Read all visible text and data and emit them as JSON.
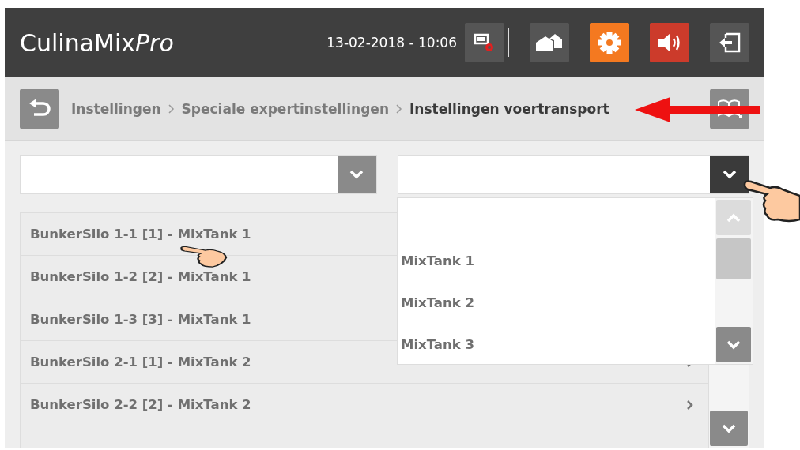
{
  "header": {
    "app_name": "CulinaMix",
    "app_name_suffix": "Pro",
    "datetime": "13-02-2018 - 10:06",
    "buttons": [
      {
        "kind": "screen",
        "color": "#555555"
      },
      {
        "kind": "houses",
        "color": "#555555"
      },
      {
        "kind": "settings",
        "color": "#f47920"
      },
      {
        "kind": "sound",
        "color": "#cc3b2b"
      },
      {
        "kind": "logout",
        "color": "#555555"
      }
    ]
  },
  "breadcrumb": [
    {
      "label": "Instellingen",
      "current": false
    },
    {
      "label": "Speciale expertinstellingen",
      "current": false
    },
    {
      "label": "Instellingen voertransport",
      "current": true
    }
  ],
  "dropdowns": [
    {
      "open": false
    },
    {
      "open": true,
      "options": [
        {
          "kind": "empty"
        },
        {
          "kind": "text",
          "label": "MixTank 1"
        },
        {
          "kind": "text",
          "label": "MixTank 2"
        },
        {
          "kind": "text",
          "label": "MixTank 3"
        }
      ]
    }
  ],
  "rows": [
    {
      "label": "BunkerSilo 1-1 [1] - MixTank 1",
      "chevron": false
    },
    {
      "label": "BunkerSilo 1-2 [2] - MixTank 1",
      "chevron": false
    },
    {
      "label": "BunkerSilo 1-3 [3] - MixTank 1",
      "chevron": false
    },
    {
      "label": "BunkerSilo 2-1 [1] - MixTank 2",
      "chevron": true
    },
    {
      "label": "BunkerSilo 2-2 [2] - MixTank 2",
      "chevron": true
    }
  ]
}
